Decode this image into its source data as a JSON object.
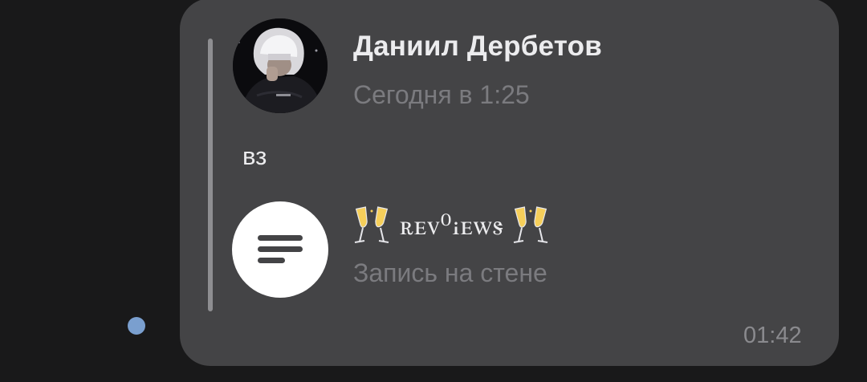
{
  "message": {
    "time": "01:42",
    "unread_indicator_color": "#7a9fcf"
  },
  "repost": {
    "author_name": "Даниил Дербетов",
    "date": "Сегодня в 1:25",
    "text": "вз"
  },
  "attachment": {
    "icon": "wall-post-lines-icon",
    "title_emoji_left": "champagne-glasses-icon",
    "title": "ꭱꭼꮩ⁰ꭵꭼꮃꮥ",
    "title_emoji_right": "champagne-glasses-icon",
    "subtitle": "Запись на стене"
  },
  "colors": {
    "background": "#19191a",
    "bubble": "#444446",
    "quote_bar": "#8e8e91",
    "primary_text": "#ececee",
    "secondary_text": "#7b7b7f"
  }
}
